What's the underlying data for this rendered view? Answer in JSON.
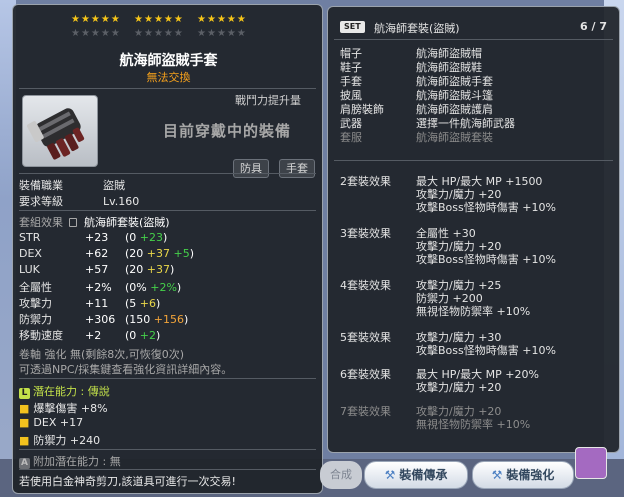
{
  "item": {
    "stars_row1": [
      "★★★★★",
      "★★★★★",
      "★★★★★"
    ],
    "stars_row2": [
      "★★★★★",
      "★★★★★",
      "★★★★★"
    ],
    "name": "航海師盜賊手套",
    "tradable": "無法交換",
    "cp_label": "戰鬥力提升量",
    "equipped_text": "目前穿戴中的裝備",
    "tags": [
      "防具",
      "手套"
    ]
  },
  "info": {
    "job_label": "裝備職業",
    "job_value": "盜賊",
    "level_label": "要求等級",
    "level_value": "Lv.160"
  },
  "set_effect": {
    "label": "套組效果",
    "value": "航海師套裝(盜賊)"
  },
  "stats": [
    {
      "label": "STR",
      "total": "+23",
      "base": "(0",
      "bonus": "+23",
      "bonus2": "",
      "close": ")"
    },
    {
      "label": "DEX",
      "total": "+62",
      "base": "(20",
      "bonus": "+37",
      "bonus2": "+5",
      "close": ")"
    },
    {
      "label": "LUK",
      "total": "+57",
      "base": "(20",
      "bonus": "+37",
      "bonus2": "",
      "close": ")"
    },
    {
      "label": "全屬性",
      "total": "+2%",
      "base": "(0%",
      "bonus": "+2%",
      "bonus2": "",
      "close": ")"
    },
    {
      "label": "攻擊力",
      "total": "+11",
      "base": "(5",
      "bonus": "+6",
      "bonus2": "",
      "close": ")"
    },
    {
      "label": "防禦力",
      "total": "+306",
      "base": "(150",
      "bonus": "+156",
      "bonus2": "",
      "close": ")"
    },
    {
      "label": "移動速度",
      "total": "+2",
      "base": "(0",
      "bonus": "+2",
      "bonus2": "",
      "close": ")"
    }
  ],
  "scroll_line": "卷軸 強化 無(剩餘8次,可恢復0次)",
  "hint_line": "可透過NPC/採集鍵查看強化資訊詳細內容。",
  "potential": {
    "title": "潛在能力 : 傳說",
    "badge": "L",
    "lines": [
      "爆擊傷害 +8%",
      "DEX +17",
      "防禦力 +240"
    ]
  },
  "additional": {
    "badge": "A",
    "text": "附加潛在能力 : 無"
  },
  "footer": "若使用白金神奇剪刀,該道具可進行一次交易!",
  "set_panel": {
    "badge": "SET",
    "title": "航海師套裝(盜賊)",
    "count": "6 / 7",
    "pieces": [
      {
        "slot": "帽子",
        "name": "航海師盜賊帽",
        "owned": true
      },
      {
        "slot": "鞋子",
        "name": "航海師盜賊鞋",
        "owned": true
      },
      {
        "slot": "手套",
        "name": "航海師盜賊手套",
        "owned": true
      },
      {
        "slot": "披風",
        "name": "航海師盜賊斗篷",
        "owned": true
      },
      {
        "slot": "肩膀裝飾",
        "name": "航海師盜賊護肩",
        "owned": true
      },
      {
        "slot": "武器",
        "name": "選擇一件航海師武器",
        "owned": true
      },
      {
        "slot": "套服",
        "name": "航海師盜賊套裝",
        "owned": false
      }
    ],
    "effects": [
      {
        "label": "2套裝效果",
        "active": true,
        "lines": [
          "最大 HP/最大 MP +1500",
          "攻擊力/魔力 +20",
          "攻擊Boss怪物時傷害 +10%"
        ]
      },
      {
        "label": "3套裝效果",
        "active": true,
        "lines": [
          "全屬性 +30",
          "攻擊力/魔力 +20",
          "攻擊Boss怪物時傷害 +10%"
        ]
      },
      {
        "label": "4套裝效果",
        "active": true,
        "lines": [
          "攻擊力/魔力 +25",
          "防禦力 +200",
          "無視怪物防禦率 +10%"
        ]
      },
      {
        "label": "5套裝效果",
        "active": true,
        "lines": [
          "攻擊力/魔力 +30",
          "攻擊Boss怪物時傷害 +10%"
        ]
      },
      {
        "label": "6套裝效果",
        "active": true,
        "lines": [
          "最大 HP/最大 MP +20%",
          "攻擊力/魔力 +20"
        ]
      },
      {
        "label": "7套裝效果",
        "active": false,
        "lines": [
          "攻擊力/魔力 +20",
          "無視怪物防禦率 +10%"
        ]
      }
    ]
  },
  "buttons": {
    "ghost": "合成",
    "inherit": "裝備傳承",
    "enhance": "裝備強化"
  },
  "colors": {
    "star_gold": "#f5c419",
    "tradable_orange": "#f4a01c",
    "bonus_green": "#45d14a",
    "bonus_yellow": "#e9d74a",
    "bonus_orange": "#f2a43a"
  }
}
